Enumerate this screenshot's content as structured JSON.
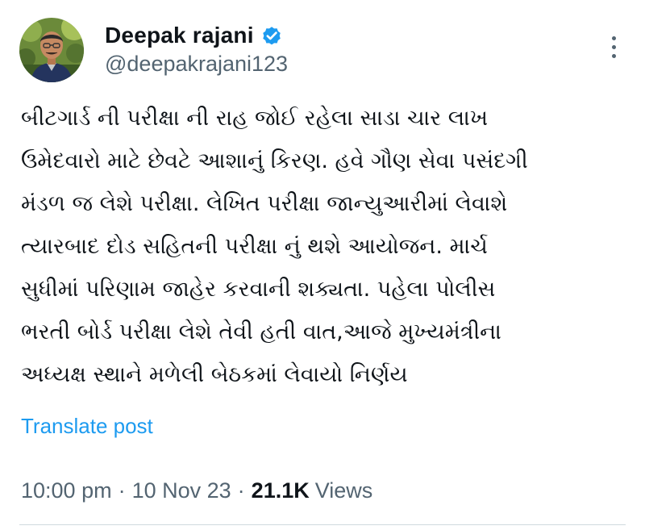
{
  "author": {
    "name": "Deepak rajani",
    "handle": "@deepakrajani123",
    "verified": true,
    "verified_color": "#1d9bf0"
  },
  "post": {
    "text": "બીટગાર્ડ ની પરીક્ષા ની રાહ જોઈ રહેલા સાડા ચાર લાખ\nઉમેદવારો માટે છેવટે આશાનું કિરણ. હવે ગૌણ સેવા પસંદગી\nમંડળ જ લેશે પરીક્ષા. લેખિત પરીક્ષા જાન્યુઆરીમાં લેવાશે\nત્યારબાદ દોડ સહિતની પરીક્ષા નું થશે આયોજન. માર્ચ\nસુધીમાં પરિણામ જાહેર કરવાની શક્યતા. પહેલા પોલીસ\nભરતી બોર્ડ પરીક્ષા લેશે તેવી હતી વાત,આજે મુખ્યમંત્રીના\nઅધ્યક્ષ સ્થાને મળેલી બેઠકમાં લેવાયો નિર્ણય",
    "translate_label": "Translate post"
  },
  "meta": {
    "time": "10:00 pm",
    "separator": "·",
    "date": "10 Nov 23",
    "views_count": "21.1K",
    "views_label": "Views"
  },
  "icons": {
    "verified": "verified-badge-icon",
    "more": "more-options-icon"
  },
  "colors": {
    "text_primary": "#0f1419",
    "text_secondary": "#536471",
    "link": "#1d9bf0",
    "divider": "#cfd9de"
  }
}
